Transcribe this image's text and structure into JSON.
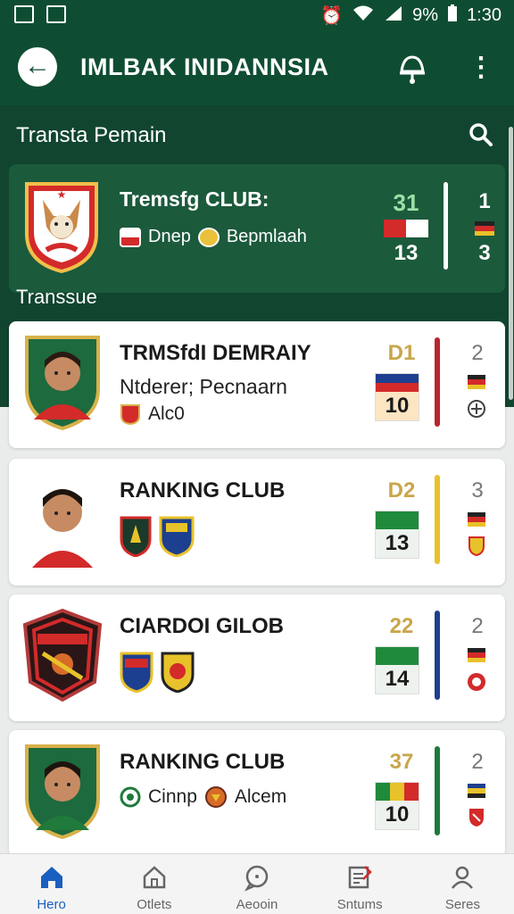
{
  "status_bar": {
    "battery": "9%",
    "time": "1:30"
  },
  "app_bar": {
    "title": "IMLBAK INIDANNSIA"
  },
  "section": {
    "title": "Transta Pemain",
    "band_label": "Transsue"
  },
  "featured": {
    "title": "Tremsfg CLUB:",
    "badge1": "Dnep",
    "badge2": "Bepmlaah",
    "score_top": "31",
    "score_bottom": "13",
    "right_top": "1",
    "right_bottom": "3"
  },
  "cards": [
    {
      "title": "TRMSfdI DEMRAIY",
      "line": "Ntderer; Pecnaarn",
      "badge": "Alc0",
      "score_top": "D1",
      "score_top_color": "#c8a64a",
      "score_bottom": "10",
      "right_top": "2",
      "divider_color": "#b8252e"
    },
    {
      "title": "RANKING CLUB",
      "score_top": "D2",
      "score_top_color": "#c8a64a",
      "score_bottom": "13",
      "right_top": "3",
      "divider_color": "#e8c22a"
    },
    {
      "title": "CIARDOI GILOB",
      "score_top": "22",
      "score_top_color": "#c8a64a",
      "score_bottom": "14",
      "right_top": "2",
      "divider_color": "#1d3f8f"
    },
    {
      "title": "RANKING CLUB",
      "badge1": "Cinnp",
      "badge2": "Alcem",
      "score_top": "37",
      "score_top_color": "#c8a64a",
      "score_bottom": "10",
      "right_top": "2",
      "divider_color": "#1f7a3c"
    }
  ],
  "nav": [
    {
      "label": "Hero",
      "icon": "home-icon"
    },
    {
      "label": "Otlets",
      "icon": "house-outline-icon"
    },
    {
      "label": "Aeooin",
      "icon": "chat-icon"
    },
    {
      "label": "Sntums",
      "icon": "edit-list-icon"
    },
    {
      "label": "Seres",
      "icon": "profile-icon"
    }
  ],
  "colors": {
    "primary": "#0f4d33",
    "band": "#11452f",
    "accent_nav": "#1a5fbf"
  }
}
